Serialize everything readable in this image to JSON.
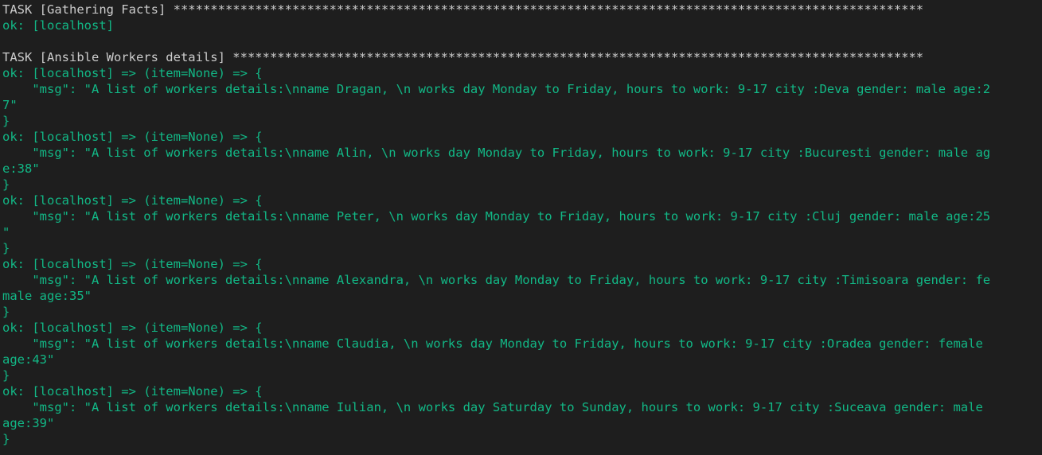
{
  "terminal": {
    "background_color": "#1e1e1e",
    "text_color": "#cccccc",
    "ok_color": "#12b886"
  },
  "tasks": [
    {
      "header": "TASK [Gathering Facts] *****************************************************************************************************",
      "results": [
        {
          "type": "simple",
          "lines": [
            "ok: [localhost]"
          ]
        }
      ]
    },
    {
      "header": "TASK [Ansible Workers details] *********************************************************************************************",
      "results": [
        {
          "type": "item",
          "lines": [
            "ok: [localhost] => (item=None) => {",
            "    \"msg\": \"A list of workers details:\\nname Dragan, \\n works day Monday to Friday, hours to work: 9-17 city :Deva gender: male age:2",
            "7\"",
            "}"
          ]
        },
        {
          "type": "item",
          "lines": [
            "ok: [localhost] => (item=None) => {",
            "    \"msg\": \"A list of workers details:\\nname Alin, \\n works day Monday to Friday, hours to work: 9-17 city :Bucuresti gender: male ag",
            "e:38\"",
            "}"
          ]
        },
        {
          "type": "item",
          "lines": [
            "ok: [localhost] => (item=None) => {",
            "    \"msg\": \"A list of workers details:\\nname Peter, \\n works day Monday to Friday, hours to work: 9-17 city :Cluj gender: male age:25",
            "\"",
            "}"
          ]
        },
        {
          "type": "item",
          "lines": [
            "ok: [localhost] => (item=None) => {",
            "    \"msg\": \"A list of workers details:\\nname Alexandra, \\n works day Monday to Friday, hours to work: 9-17 city :Timisoara gender: fe",
            "male age:35\"",
            "}"
          ]
        },
        {
          "type": "item",
          "lines": [
            "ok: [localhost] => (item=None) => {",
            "    \"msg\": \"A list of workers details:\\nname Claudia, \\n works day Monday to Friday, hours to work: 9-17 city :Oradea gender: female",
            "age:43\"",
            "}"
          ]
        },
        {
          "type": "item",
          "lines": [
            "ok: [localhost] => (item=None) => {",
            "    \"msg\": \"A list of workers details:\\nname Iulian, \\n works day Saturday to Sunday, hours to work: 9-17 city :Suceava gender: male",
            "age:39\"",
            "}"
          ]
        }
      ]
    }
  ]
}
